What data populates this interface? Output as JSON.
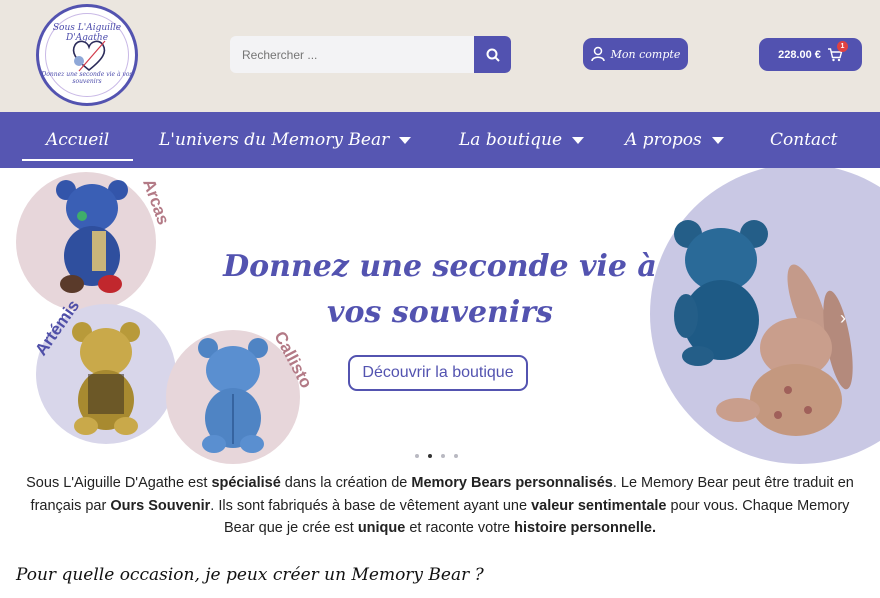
{
  "header": {
    "logo": {
      "top_text": "Sous L'Aiguille D'Agathe",
      "bottom_text": "Donnez une seconde vie à vos souvenirs"
    },
    "search": {
      "placeholder": "Rechercher ...",
      "icon": "search-icon"
    },
    "account": {
      "label": "Mon compte",
      "icon": "user-icon"
    },
    "cart": {
      "total": "228.00 €",
      "count": "1",
      "icon": "cart-icon"
    },
    "colors": {
      "accent": "#5252b0",
      "background": "#ebe6df"
    }
  },
  "nav": {
    "items": [
      {
        "label": "Accueil",
        "has_dropdown": false,
        "active": true
      },
      {
        "label": "L'univers du Memory Bear",
        "has_dropdown": true
      },
      {
        "label": "La boutique",
        "has_dropdown": true
      },
      {
        "label": "A propos",
        "has_dropdown": true
      },
      {
        "label": "Contact",
        "has_dropdown": false
      }
    ]
  },
  "hero": {
    "title": "Donnez une seconde vie à vos souvenirs",
    "button": "Découvrir la boutique",
    "bears": [
      {
        "name": "Arcas"
      },
      {
        "name": "Artémis"
      },
      {
        "name": "Callisto"
      }
    ],
    "slides": 4,
    "active_slide": 2
  },
  "intro": {
    "p1": "Sous L'Aiguille D'Agathe est ",
    "b1": "spécialisé",
    "p2": " dans la création de ",
    "b2": "Memory Bears personnalisés",
    "p3": ". Le Memory Bear peut être traduit en français par ",
    "b3": "Ours Souvenir",
    "p4": ". Ils sont fabriqués à base de vêtement ayant une ",
    "b4": "valeur sentimentale",
    "p5": " pour vous. Chaque Memory Bear que je crée est ",
    "b5": "unique",
    "p6": " et raconte votre ",
    "b6": "histoire personnelle."
  },
  "section": {
    "heading": "Pour quelle occasion, je peux créer un Memory Bear ?"
  }
}
